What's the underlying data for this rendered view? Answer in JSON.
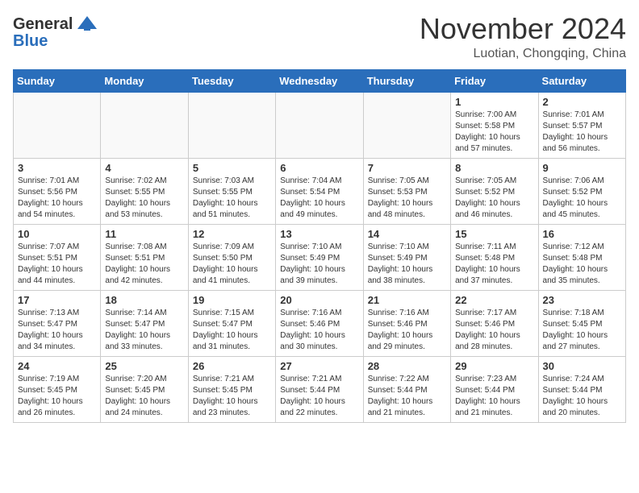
{
  "header": {
    "logo_general": "General",
    "logo_blue": "Blue",
    "month_title": "November 2024",
    "location": "Luotian, Chongqing, China"
  },
  "calendar": {
    "days_of_week": [
      "Sunday",
      "Monday",
      "Tuesday",
      "Wednesday",
      "Thursday",
      "Friday",
      "Saturday"
    ],
    "weeks": [
      [
        {
          "day": "",
          "info": ""
        },
        {
          "day": "",
          "info": ""
        },
        {
          "day": "",
          "info": ""
        },
        {
          "day": "",
          "info": ""
        },
        {
          "day": "",
          "info": ""
        },
        {
          "day": "1",
          "info": "Sunrise: 7:00 AM\nSunset: 5:58 PM\nDaylight: 10 hours\nand 57 minutes."
        },
        {
          "day": "2",
          "info": "Sunrise: 7:01 AM\nSunset: 5:57 PM\nDaylight: 10 hours\nand 56 minutes."
        }
      ],
      [
        {
          "day": "3",
          "info": "Sunrise: 7:01 AM\nSunset: 5:56 PM\nDaylight: 10 hours\nand 54 minutes."
        },
        {
          "day": "4",
          "info": "Sunrise: 7:02 AM\nSunset: 5:55 PM\nDaylight: 10 hours\nand 53 minutes."
        },
        {
          "day": "5",
          "info": "Sunrise: 7:03 AM\nSunset: 5:55 PM\nDaylight: 10 hours\nand 51 minutes."
        },
        {
          "day": "6",
          "info": "Sunrise: 7:04 AM\nSunset: 5:54 PM\nDaylight: 10 hours\nand 49 minutes."
        },
        {
          "day": "7",
          "info": "Sunrise: 7:05 AM\nSunset: 5:53 PM\nDaylight: 10 hours\nand 48 minutes."
        },
        {
          "day": "8",
          "info": "Sunrise: 7:05 AM\nSunset: 5:52 PM\nDaylight: 10 hours\nand 46 minutes."
        },
        {
          "day": "9",
          "info": "Sunrise: 7:06 AM\nSunset: 5:52 PM\nDaylight: 10 hours\nand 45 minutes."
        }
      ],
      [
        {
          "day": "10",
          "info": "Sunrise: 7:07 AM\nSunset: 5:51 PM\nDaylight: 10 hours\nand 44 minutes."
        },
        {
          "day": "11",
          "info": "Sunrise: 7:08 AM\nSunset: 5:51 PM\nDaylight: 10 hours\nand 42 minutes."
        },
        {
          "day": "12",
          "info": "Sunrise: 7:09 AM\nSunset: 5:50 PM\nDaylight: 10 hours\nand 41 minutes."
        },
        {
          "day": "13",
          "info": "Sunrise: 7:10 AM\nSunset: 5:49 PM\nDaylight: 10 hours\nand 39 minutes."
        },
        {
          "day": "14",
          "info": "Sunrise: 7:10 AM\nSunset: 5:49 PM\nDaylight: 10 hours\nand 38 minutes."
        },
        {
          "day": "15",
          "info": "Sunrise: 7:11 AM\nSunset: 5:48 PM\nDaylight: 10 hours\nand 37 minutes."
        },
        {
          "day": "16",
          "info": "Sunrise: 7:12 AM\nSunset: 5:48 PM\nDaylight: 10 hours\nand 35 minutes."
        }
      ],
      [
        {
          "day": "17",
          "info": "Sunrise: 7:13 AM\nSunset: 5:47 PM\nDaylight: 10 hours\nand 34 minutes."
        },
        {
          "day": "18",
          "info": "Sunrise: 7:14 AM\nSunset: 5:47 PM\nDaylight: 10 hours\nand 33 minutes."
        },
        {
          "day": "19",
          "info": "Sunrise: 7:15 AM\nSunset: 5:47 PM\nDaylight: 10 hours\nand 31 minutes."
        },
        {
          "day": "20",
          "info": "Sunrise: 7:16 AM\nSunset: 5:46 PM\nDaylight: 10 hours\nand 30 minutes."
        },
        {
          "day": "21",
          "info": "Sunrise: 7:16 AM\nSunset: 5:46 PM\nDaylight: 10 hours\nand 29 minutes."
        },
        {
          "day": "22",
          "info": "Sunrise: 7:17 AM\nSunset: 5:46 PM\nDaylight: 10 hours\nand 28 minutes."
        },
        {
          "day": "23",
          "info": "Sunrise: 7:18 AM\nSunset: 5:45 PM\nDaylight: 10 hours\nand 27 minutes."
        }
      ],
      [
        {
          "day": "24",
          "info": "Sunrise: 7:19 AM\nSunset: 5:45 PM\nDaylight: 10 hours\nand 26 minutes."
        },
        {
          "day": "25",
          "info": "Sunrise: 7:20 AM\nSunset: 5:45 PM\nDaylight: 10 hours\nand 24 minutes."
        },
        {
          "day": "26",
          "info": "Sunrise: 7:21 AM\nSunset: 5:45 PM\nDaylight: 10 hours\nand 23 minutes."
        },
        {
          "day": "27",
          "info": "Sunrise: 7:21 AM\nSunset: 5:44 PM\nDaylight: 10 hours\nand 22 minutes."
        },
        {
          "day": "28",
          "info": "Sunrise: 7:22 AM\nSunset: 5:44 PM\nDaylight: 10 hours\nand 21 minutes."
        },
        {
          "day": "29",
          "info": "Sunrise: 7:23 AM\nSunset: 5:44 PM\nDaylight: 10 hours\nand 21 minutes."
        },
        {
          "day": "30",
          "info": "Sunrise: 7:24 AM\nSunset: 5:44 PM\nDaylight: 10 hours\nand 20 minutes."
        }
      ]
    ]
  }
}
